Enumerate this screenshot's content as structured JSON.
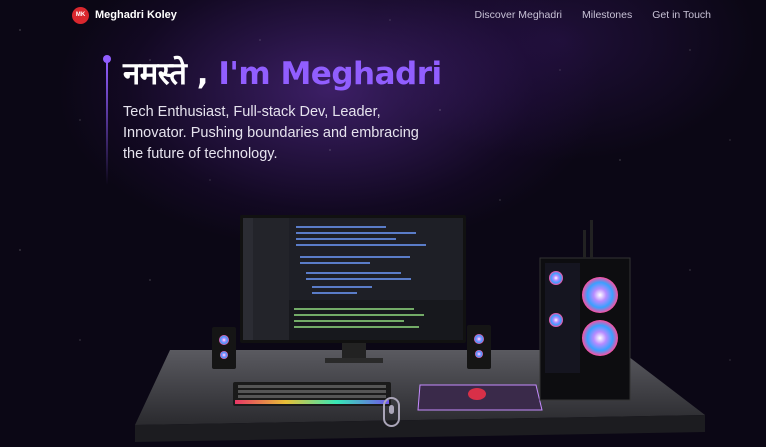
{
  "nav": {
    "logo_text": "MK",
    "brand": "Meghadri Koley",
    "links": [
      "Discover Meghadri",
      "Milestones",
      "Get in Touch"
    ]
  },
  "hero": {
    "greeting": "नमस्ते ,",
    "name": "I'm Meghadri",
    "subtitle": "Tech Enthusiast, Full-stack Dev, Leader, Innovator. Pushing boundaries and embracing the future of technology."
  },
  "colors": {
    "accent": "#915eff",
    "logo_bg": "#d9272e",
    "background": "#0b0715"
  },
  "icons": [
    "scroll-indicator-icon"
  ]
}
